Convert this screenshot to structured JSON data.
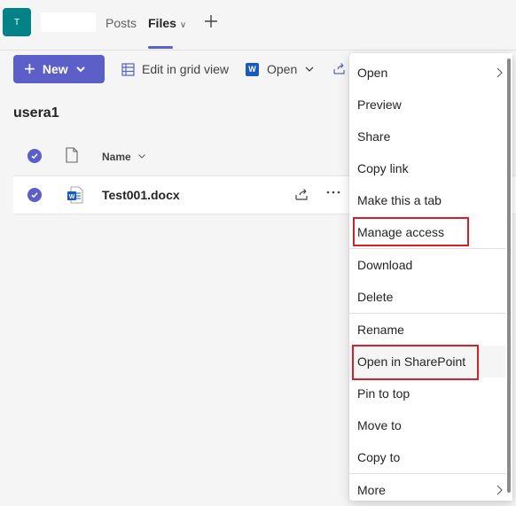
{
  "team": {
    "avatar_initial": "T"
  },
  "tabs": [
    {
      "label": "Posts"
    },
    {
      "label": "Files"
    }
  ],
  "toolbar": {
    "new_label": "New",
    "edit_grid_label": "Edit in grid view",
    "open_label": "Open"
  },
  "library": {
    "title": "usera1",
    "columns": {
      "name": "Name"
    },
    "files": [
      {
        "name": "Test001.docx",
        "type": "word"
      }
    ]
  },
  "context_menu": {
    "items": [
      {
        "label": "Open",
        "has_submenu": true
      },
      {
        "label": "Preview"
      },
      {
        "label": "Share"
      },
      {
        "label": "Copy link"
      },
      {
        "label": "Make this a tab"
      },
      {
        "label": "Manage access",
        "highlighted": true
      },
      {
        "label": "Download"
      },
      {
        "label": "Delete"
      },
      {
        "label": "Rename"
      },
      {
        "label": "Open in SharePoint",
        "highlighted": true
      },
      {
        "label": "Pin to top"
      },
      {
        "label": "Move to"
      },
      {
        "label": "Copy to"
      },
      {
        "label": "More",
        "has_submenu": true
      }
    ]
  },
  "colors": {
    "accent": "#5b5fc7",
    "team_avatar": "#038387",
    "highlight_box": "#d71e2b",
    "word_blue": "#185abd"
  }
}
